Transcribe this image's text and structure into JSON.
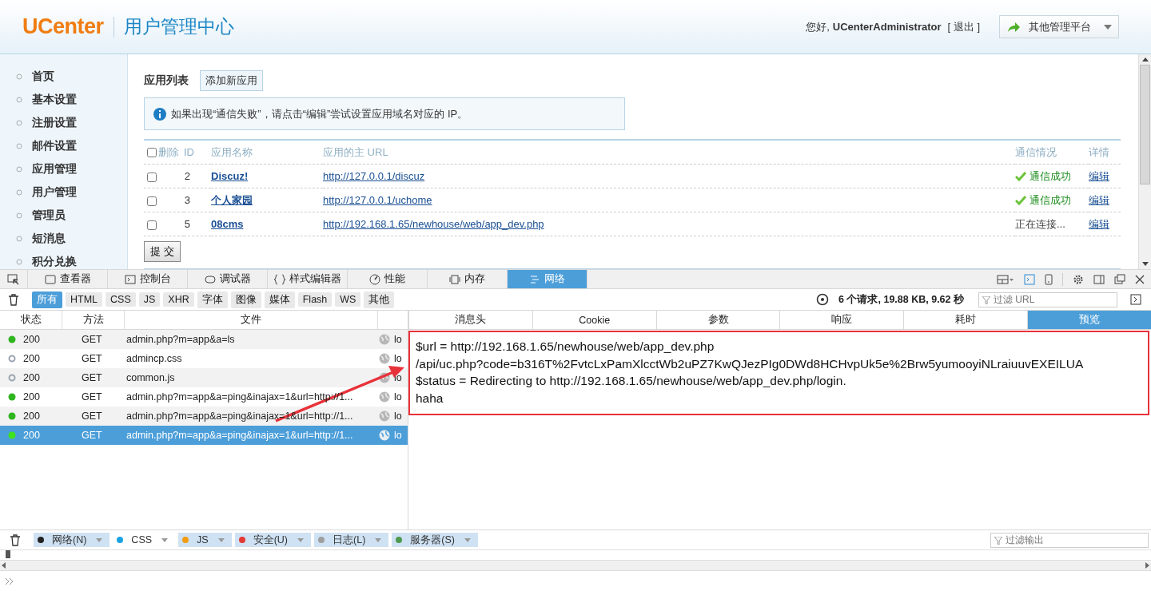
{
  "header": {
    "logo": "UCenter",
    "title": "用户管理中心",
    "greeting": "您好,",
    "user": "UCenterAdministrator",
    "logout": "[ 退出 ]",
    "platform_menu": "其他管理平台"
  },
  "sidebar": {
    "items": [
      "首页",
      "基本设置",
      "注册设置",
      "邮件设置",
      "应用管理",
      "用户管理",
      "管理员",
      "短消息",
      "积分兑换"
    ]
  },
  "content": {
    "heading": "应用列表",
    "add_button": "添加新应用",
    "notice": "如果出现“通信失败”，请点击“编辑”尝试设置应用域名对应的 IP。",
    "select_all_checked": false,
    "columns": [
      "删除",
      "ID",
      "应用名称",
      "应用的主 URL",
      "通信情况",
      "详情"
    ],
    "rows": [
      {
        "checked": false,
        "id": "2",
        "name": "Discuz!",
        "url": "http://127.0.0.1/discuz",
        "status": "通信成功",
        "connected": true,
        "action": "编辑"
      },
      {
        "checked": false,
        "id": "3",
        "name": "个人家园",
        "url": "http://127.0.0.1/uchome",
        "status": "通信成功",
        "connected": true,
        "action": "编辑"
      },
      {
        "checked": false,
        "id": "5",
        "name": "08cms",
        "url": "http://192.168.1.65/newhouse/web/app_dev.php",
        "status": "正在连接...",
        "connected": false,
        "action": "编辑"
      }
    ],
    "submit": "提 交"
  },
  "devtools": {
    "tabs": [
      {
        "label": "查看器",
        "selected": false
      },
      {
        "label": "控制台",
        "selected": false
      },
      {
        "label": "调试器",
        "selected": false
      },
      {
        "label": "样式编辑器",
        "selected": false
      },
      {
        "label": "性能",
        "selected": false
      },
      {
        "label": "内存",
        "selected": false
      },
      {
        "label": "网络",
        "selected": true
      }
    ],
    "filters": [
      {
        "label": "所有",
        "selected": true
      },
      {
        "label": "HTML",
        "selected": false
      },
      {
        "label": "CSS",
        "selected": false
      },
      {
        "label": "JS",
        "selected": false
      },
      {
        "label": "XHR",
        "selected": false
      },
      {
        "label": "字体",
        "selected": false
      },
      {
        "label": "图像",
        "selected": false
      },
      {
        "label": "媒体",
        "selected": false
      },
      {
        "label": "Flash",
        "selected": false
      },
      {
        "label": "WS",
        "selected": false
      },
      {
        "label": "其他",
        "selected": false
      }
    ],
    "summary": "6 个请求, 19.88 KB, 9.62 秒",
    "filter_placeholder": "过滤 URL",
    "request_columns": [
      "状态",
      "方法",
      "文件"
    ],
    "requests": [
      {
        "cached": false,
        "status": "200",
        "method": "GET",
        "file": "admin.php?m=app&a=ls",
        "domain": "lo",
        "selected": false
      },
      {
        "cached": true,
        "status": "200",
        "method": "GET",
        "file": "admincp.css",
        "domain": "lo",
        "selected": false
      },
      {
        "cached": true,
        "status": "200",
        "method": "GET",
        "file": "common.js",
        "domain": "lo",
        "selected": false
      },
      {
        "cached": false,
        "status": "200",
        "method": "GET",
        "file": "admin.php?m=app&a=ping&inajax=1&url=http://1...",
        "domain": "lo",
        "selected": false
      },
      {
        "cached": false,
        "status": "200",
        "method": "GET",
        "file": "admin.php?m=app&a=ping&inajax=1&url=http://1...",
        "domain": "lo",
        "selected": false
      },
      {
        "cached": false,
        "status": "200",
        "method": "GET",
        "file": "admin.php?m=app&a=ping&inajax=1&url=http://1...",
        "domain": "lo",
        "selected": true
      }
    ],
    "detail_tabs": [
      {
        "label": "消息头",
        "selected": false
      },
      {
        "label": "Cookie",
        "selected": false
      },
      {
        "label": "参数",
        "selected": false
      },
      {
        "label": "响应",
        "selected": false
      },
      {
        "label": "耗时",
        "selected": false
      },
      {
        "label": "预览",
        "selected": true
      }
    ],
    "preview": [
      "$url = http://192.168.1.65/newhouse/web/app_dev.php",
      "/api/uc.php?code=b316T%2FvtcLxPamXlcctWb2uPZ7KwQJezPIg0DWd8HCHvpUk5e%2Brw5yumooyiNLraiuuvEXEILUA",
      "$status = Redirecting to http://192.168.1.65/newhouse/web/app_dev.php/login.",
      "haha"
    ]
  },
  "console": {
    "filters": [
      {
        "label": "网络(N)",
        "color": "#222222",
        "on": true
      },
      {
        "label": "CSS",
        "color": "#1aa3e0",
        "on": false
      },
      {
        "label": "JS",
        "color": "#f39c12",
        "on": true
      },
      {
        "label": "安全(U)",
        "color": "#e53935",
        "on": true
      },
      {
        "label": "日志(L)",
        "color": "#9e9e9e",
        "on": true
      },
      {
        "label": "服务器(S)",
        "color": "#4f9a4f",
        "on": true
      }
    ],
    "filter_placeholder": "过滤输出"
  }
}
